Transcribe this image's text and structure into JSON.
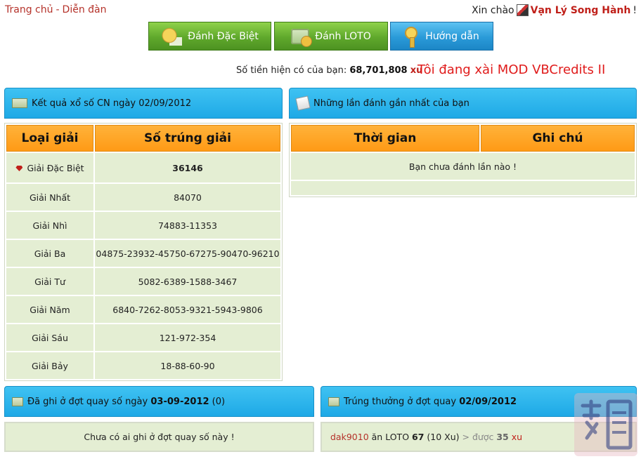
{
  "nav": {
    "home": "Trang chủ",
    "sep": "-",
    "forum": "Diễn đàn"
  },
  "user": {
    "greeting": "Xin chào",
    "name": "Vạn Lý Song Hành",
    "suffix": "!"
  },
  "buttons": {
    "special": "Đánh Đặc Biệt",
    "loto": "Đánh LOTO",
    "guide": "Hướng dẫn"
  },
  "balance": {
    "label": "Số tiền hiện có của bạn:",
    "amount": "68,701,808",
    "unit": "xu"
  },
  "mod_notice": "Tôi đang xài MOD VBCredits II",
  "results": {
    "title": "Kết quả xổ số CN ngày 02/09/2012",
    "headers": [
      "Loại giải",
      "Số trúng giải"
    ],
    "rows": [
      {
        "prize": "Giải Đặc Biệt",
        "numbers": "36146"
      },
      {
        "prize": "Giải Nhất",
        "numbers": "84070"
      },
      {
        "prize": "Giải Nhì",
        "numbers": "74883-11353"
      },
      {
        "prize": "Giải Ba",
        "numbers": "04875-23932-45750-67275-90470-96210"
      },
      {
        "prize": "Giải Tư",
        "numbers": "5082-6389-1588-3467"
      },
      {
        "prize": "Giải Năm",
        "numbers": "6840-7262-8053-9321-5943-9806"
      },
      {
        "prize": "Giải Sáu",
        "numbers": "121-972-354"
      },
      {
        "prize": "Giải Bảy",
        "numbers": "18-88-60-90"
      }
    ]
  },
  "recent": {
    "title": "Những lần đánh gần nhất của bạn",
    "headers": [
      "Thời gian",
      "Ghi chú"
    ],
    "empty": "Bạn chưa đánh lần nào !"
  },
  "recorded": {
    "title_prefix": "Đã ghi ở đợt quay số ngày",
    "date": "03-09-2012",
    "count": "(0)",
    "empty": "Chưa có ai ghi ở đợt quay số này !"
  },
  "winners": {
    "title_prefix": "Trúng thưởng ở đợt quay",
    "date": "02/09/2012",
    "entry": {
      "user": "dak9010",
      "action": "ăn LOTO",
      "number": "67",
      "stake": "(10 Xu)",
      "arrow": ">",
      "got": "được",
      "amount": "35",
      "unit": "xu"
    }
  },
  "colors": {
    "link": "#b5322a",
    "header_blue": "#1ea9e6",
    "table_orange": "#ff9a16",
    "cell_green": "#e4eed3"
  }
}
